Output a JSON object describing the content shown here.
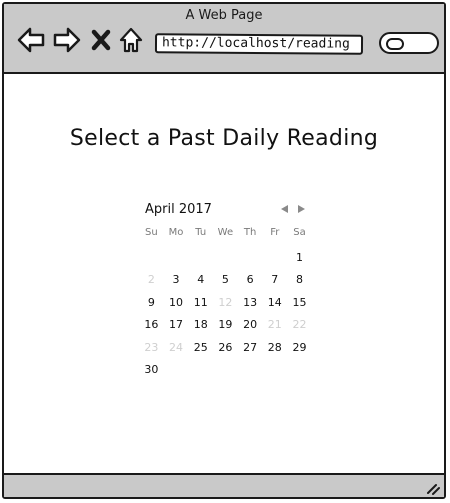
{
  "window": {
    "title": "A Web Page"
  },
  "toolbar": {
    "icons": [
      "back-arrow-icon",
      "forward-arrow-icon",
      "close-x-icon",
      "home-icon"
    ],
    "url": "http://localhost/reading",
    "search_icon": "search-icon"
  },
  "page": {
    "heading": "Select a Past Daily Reading"
  },
  "calendar": {
    "month_label": "April 2017",
    "prev_icon": "prev-triangle-icon",
    "next_icon": "next-triangle-icon",
    "weekdays": [
      "Su",
      "Mo",
      "Tu",
      "We",
      "Th",
      "Fr",
      "Sa"
    ],
    "weeks": [
      [
        "",
        "",
        "",
        "",
        "",
        "",
        "1"
      ],
      [
        "2",
        "3",
        "4",
        "5",
        "6",
        "7",
        "8"
      ],
      [
        "9",
        "10",
        "11",
        "12",
        "13",
        "14",
        "15"
      ],
      [
        "16",
        "17",
        "18",
        "19",
        "20",
        "21",
        "22"
      ],
      [
        "23",
        "24",
        "25",
        "26",
        "27",
        "28",
        "29"
      ],
      [
        "30",
        "",
        "",
        "",
        "",
        "",
        ""
      ]
    ],
    "disabled_days": [
      "2",
      "12",
      "21",
      "22",
      "23",
      "24"
    ],
    "muted_color": "#cfcfcf",
    "active_color": "#111111"
  },
  "statusbar": {
    "grip_icon": "resize-grip-icon"
  }
}
